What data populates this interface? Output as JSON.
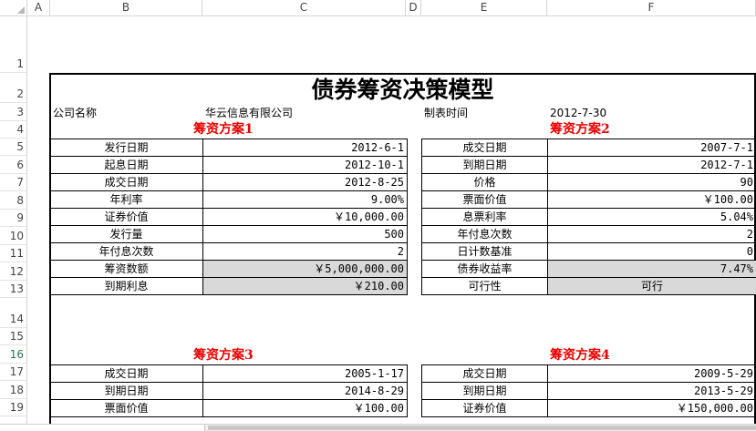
{
  "columns": [
    "A",
    "B",
    "C",
    "D",
    "E",
    "F"
  ],
  "rows": [
    "1",
    "2",
    "3",
    "4",
    "5",
    "6",
    "7",
    "8",
    "9",
    "10",
    "11",
    "12",
    "13",
    "14",
    "15",
    "16",
    "17",
    "18",
    "19"
  ],
  "title": "债券筹资决策模型",
  "company_label": "公司名称",
  "company_name": "华云信息有限公司",
  "date_label": "制表时间",
  "date_value": "2012-7-30",
  "plan1": {
    "title": "筹资方案1",
    "rows": [
      {
        "label": "发行日期",
        "value": "2012-6-1"
      },
      {
        "label": "起息日期",
        "value": "2012-10-1"
      },
      {
        "label": "成交日期",
        "value": "2012-8-25"
      },
      {
        "label": "年利率",
        "value": "9.00%"
      },
      {
        "label": "证券价值",
        "value": "￥10,000.00"
      },
      {
        "label": "发行量",
        "value": "500"
      },
      {
        "label": "年付息次数",
        "value": "2"
      },
      {
        "label": "筹资数额",
        "value": "￥5,000,000.00"
      },
      {
        "label": "到期利息",
        "value": "￥210.00"
      }
    ]
  },
  "plan2": {
    "title": "筹资方案2",
    "rows": [
      {
        "label": "成交日期",
        "value": "2007-7-1"
      },
      {
        "label": "到期日期",
        "value": "2012-7-1"
      },
      {
        "label": "价格",
        "value": "90"
      },
      {
        "label": "票面价值",
        "value": "￥100.00"
      },
      {
        "label": "息票利率",
        "value": "5.04%"
      },
      {
        "label": "年付息次数",
        "value": "2"
      },
      {
        "label": "日计数基准",
        "value": "0"
      },
      {
        "label": "债券收益率",
        "value": "7.47%"
      },
      {
        "label": "可行性",
        "value": "可行"
      }
    ]
  },
  "plan3": {
    "title": "筹资方案3",
    "rows": [
      {
        "label": "成交日期",
        "value": "2005-1-17"
      },
      {
        "label": "到期日期",
        "value": "2014-8-29"
      },
      {
        "label": "票面价值",
        "value": "￥100.00"
      }
    ]
  },
  "plan4": {
    "title": "筹资方案4",
    "rows": [
      {
        "label": "成交日期",
        "value": "2009-5-29"
      },
      {
        "label": "到期日期",
        "value": "2013-5-29"
      },
      {
        "label": "证券价值",
        "value": "￥150,000.00"
      }
    ]
  }
}
